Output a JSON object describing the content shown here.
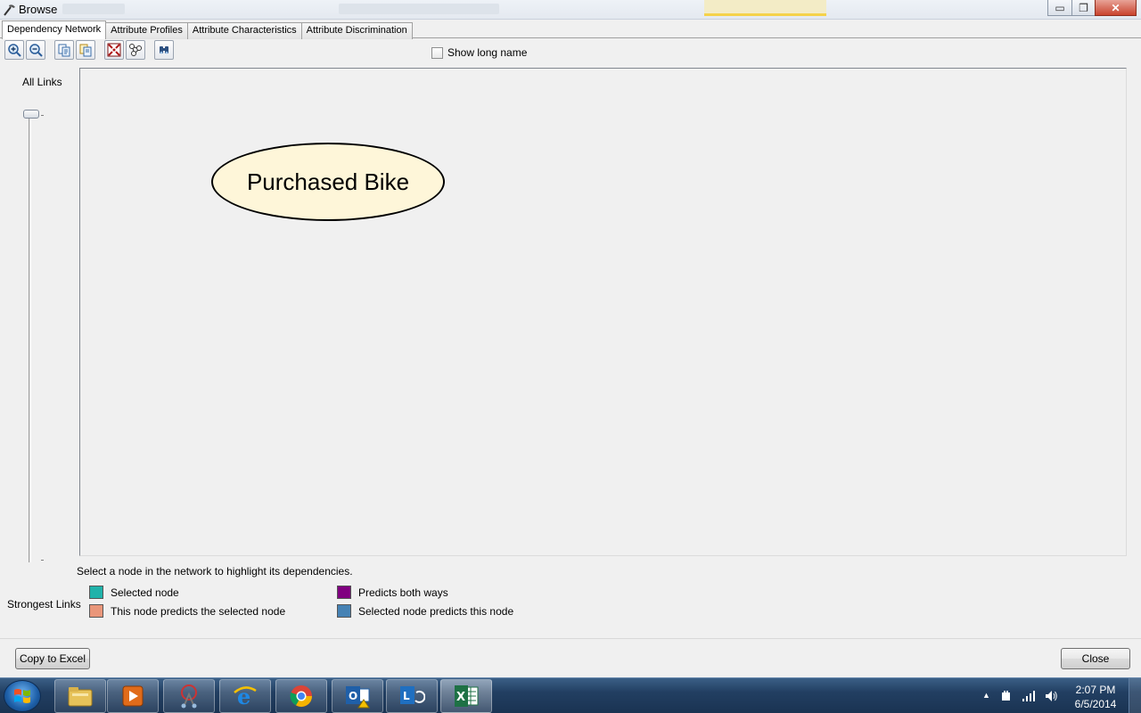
{
  "window": {
    "title": "Browse",
    "buttons": {
      "minimize": "▭",
      "restore": "❐",
      "close": "✕"
    }
  },
  "tabs": [
    {
      "label": "Dependency Network",
      "active": true
    },
    {
      "label": "Attribute Profiles",
      "active": false
    },
    {
      "label": "Attribute Characteristics",
      "active": false
    },
    {
      "label": "Attribute Discrimination",
      "active": false
    }
  ],
  "toolbar": {
    "buttons": [
      "zoom-in-icon",
      "zoom-out-icon",
      "copy-graph-icon",
      "copy-graph-view-icon",
      "fit-to-window-icon",
      "layout-icon",
      "find-node-icon"
    ],
    "show_long_name": {
      "label": "Show long name",
      "checked": false
    }
  },
  "slider": {
    "top_label": "All Links",
    "bottom_label": "Strongest Links",
    "level": 1.0
  },
  "network": {
    "nodes": [
      {
        "label": "Purchased Bike",
        "fill": "#fef6d9"
      }
    ]
  },
  "hint": "Select a node in the network to highlight its dependencies.",
  "legend": {
    "items": [
      {
        "label": "Selected node",
        "color": "#20b2aa"
      },
      {
        "label": "This node predicts the selected node",
        "color": "#e9967a"
      },
      {
        "label": "Predicts both ways",
        "color": "#800080"
      },
      {
        "label": "Selected node predicts this node",
        "color": "#4682b4"
      }
    ]
  },
  "footer": {
    "copy_button": "Copy to Excel",
    "close_button": "Close"
  },
  "taskbar": {
    "apps": [
      "file-explorer-icon",
      "media-player-icon",
      "snipping-tool-icon",
      "internet-explorer-icon",
      "chrome-icon",
      "outlook-icon",
      "lync-icon",
      "excel-icon"
    ],
    "clock_time": "2:07 PM",
    "clock_date": "6/5/2014"
  }
}
